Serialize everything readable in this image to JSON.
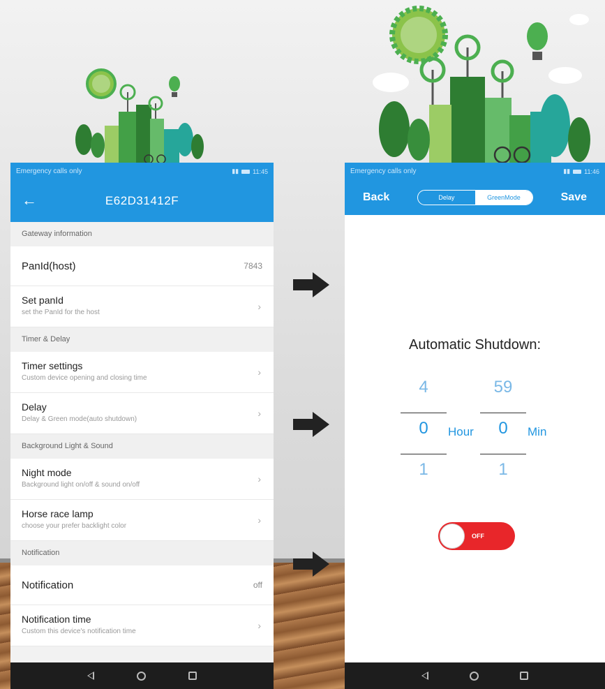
{
  "left_phone": {
    "status": {
      "carrier": "Emergency calls only",
      "time": "11:45"
    },
    "appbar": {
      "title": "E62D31412F"
    },
    "sections": [
      {
        "header": "Gateway information",
        "rows": [
          {
            "label": "PanId(host)",
            "value": "7843"
          },
          {
            "label": "Set panId",
            "sub": "set the PanId for the host"
          }
        ]
      },
      {
        "header": "Timer & Delay",
        "rows": [
          {
            "label": "Timer settings",
            "sub": "Custom device opening and closing time"
          },
          {
            "label": "Delay",
            "sub": "Delay & Green mode(auto shutdown)"
          }
        ]
      },
      {
        "header": "Background Light & Sound",
        "rows": [
          {
            "label": "Night mode",
            "sub": "Background light on/off & sound on/off"
          },
          {
            "label": "Horse race lamp",
            "sub": "choose your prefer backlight color"
          }
        ]
      },
      {
        "header": "Notification",
        "rows": [
          {
            "label": "Notification",
            "value": "off"
          },
          {
            "label": "Notification time",
            "sub": "Custom this device's notification time"
          }
        ]
      }
    ]
  },
  "right_phone": {
    "status": {
      "carrier": "Emergency calls only",
      "time": "11:46"
    },
    "appbar": {
      "back": "Back",
      "seg_delay": "Delay",
      "seg_green": "GreenMode",
      "save": "Save"
    },
    "title": "Automatic Shutdown:",
    "picker": {
      "hour": {
        "prev": "4",
        "current": "0",
        "next": "1",
        "unit": "Hour"
      },
      "min": {
        "prev": "59",
        "current": "0",
        "next": "1",
        "unit": "Min"
      }
    },
    "toggle": {
      "state": "OFF"
    }
  },
  "colors": {
    "primary": "#2196e0",
    "toggle_off": "#e8262a",
    "navbar": "#1d1d1d"
  }
}
